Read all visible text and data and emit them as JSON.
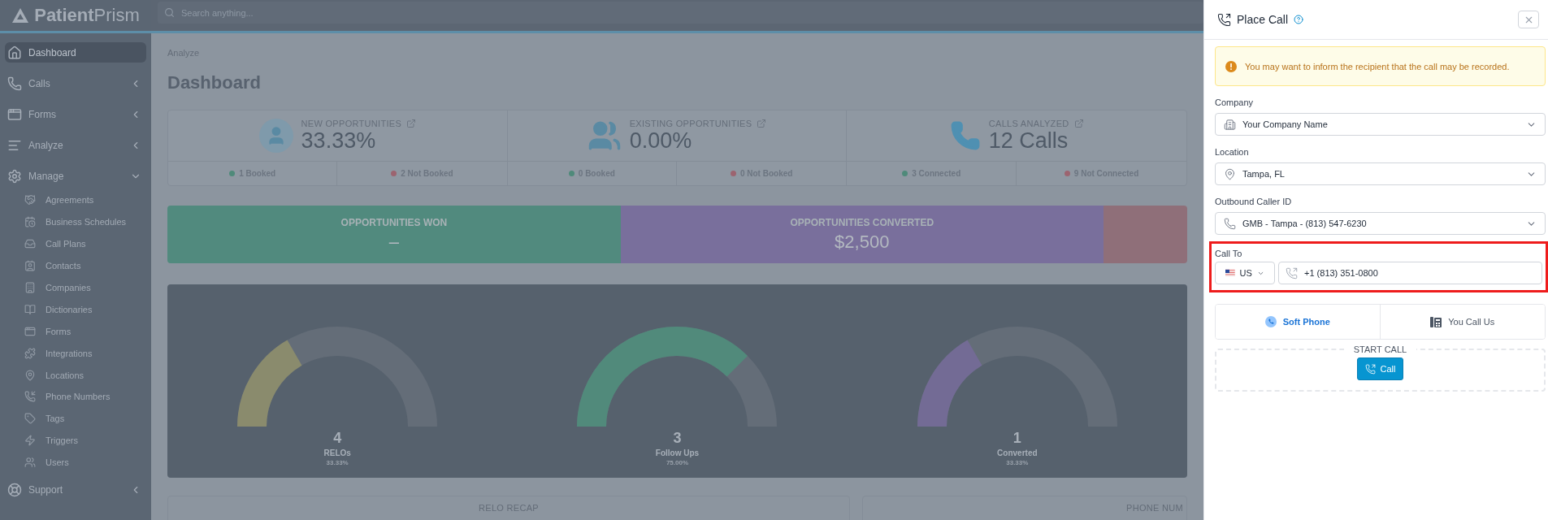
{
  "sidebar": {
    "logo": "**Patient**Prism",
    "items": [
      {
        "label": "Dashboard",
        "selected": true
      },
      {
        "label": "Calls",
        "selected": false,
        "expanded": false
      },
      {
        "label": "Forms",
        "selected": false,
        "expanded": false
      },
      {
        "label": "Analyze",
        "selected": false,
        "expanded": false
      },
      {
        "label": "Manage",
        "selected": false,
        "expanded": true,
        "children": [
          {
            "label": "Agreements",
            "selected": false
          },
          {
            "label": "Business Schedules",
            "selected": false
          },
          {
            "label": "Call Plans",
            "selected": false
          },
          {
            "label": "Contacts",
            "selected": false
          },
          {
            "label": "Companies",
            "selected": false
          },
          {
            "label": "Dictionaries",
            "selected": false
          },
          {
            "label": "Forms",
            "selected": false
          },
          {
            "label": "Integrations",
            "selected": false
          },
          {
            "label": "Locations",
            "selected": false
          },
          {
            "label": "Phone Numbers",
            "selected": false
          },
          {
            "label": "Tags",
            "selected": false
          },
          {
            "label": "Triggers",
            "selected": false
          },
          {
            "label": "Users",
            "selected": false
          }
        ]
      },
      {
        "label": "Support",
        "selected": false,
        "expanded": false
      }
    ]
  },
  "search": {
    "placeholder": "Search anything..."
  },
  "breadcrumb": "Analyze",
  "title": "Dashboard",
  "stats": [
    {
      "title": "NEW OPPORTUNITIES",
      "value": "33.33%",
      "breakdown": [
        {
          "text": "1 Booked",
          "color": "#4f8a7a"
        },
        {
          "text": "2 Not Booked",
          "color": "#9c6470"
        }
      ]
    },
    {
      "title": "EXISTING OPPORTUNITIES",
      "value": "0.00%",
      "breakdown": [
        {
          "text": "0 Booked",
          "color": "#4f8a7a"
        },
        {
          "text": "0 Not Booked",
          "color": "#9c6470"
        }
      ]
    },
    {
      "title": "CALLS ANALYZED",
      "value": "12 Calls",
      "breakdown": [
        {
          "text": "3 Connected",
          "color": "#4f8a7a"
        },
        {
          "text": "9 Not Connected",
          "color": "#9c6470"
        }
      ]
    }
  ],
  "banners": [
    {
      "label": "OPPORTUNITIES WON",
      "value": "–",
      "color": "#518a7e"
    },
    {
      "label": "OPPORTUNITIES CONVERTED",
      "value": "$2,500",
      "color": "#796f9c"
    },
    {
      "color": "#8f6f79"
    }
  ],
  "gauges": [
    {
      "value": "4",
      "label": "RELOs",
      "percent": "33.33%",
      "color": "#8a8b6d"
    },
    {
      "value": "3",
      "label": "Follow Ups",
      "percent": "75.00%",
      "color": "#518a7b"
    },
    {
      "value": "1",
      "label": "Converted",
      "percent": "33.33%",
      "color": "#736b95"
    }
  ],
  "recaps": [
    {
      "title": "RELO RECAP"
    },
    {
      "title": "PHONE NUM"
    }
  ],
  "drawer": {
    "title": "Place Call",
    "alert": "You may want to inform the recipient that the call may be recorded.",
    "fields": [
      {
        "label": "Company",
        "value": "Your Company Name"
      },
      {
        "label": "Location",
        "value": "Tampa, FL"
      },
      {
        "label": "Outbound Caller ID",
        "value": "GMB - Tampa - (813) 547-6230"
      }
    ],
    "call_to": {
      "label": "Call To",
      "country": "US",
      "number": "+1 (813) 351-0800",
      "highlighted": true
    },
    "tabs": [
      {
        "label": "Soft Phone",
        "selected": true
      },
      {
        "label": "You Call Us",
        "selected": false
      }
    ],
    "start_call": {
      "legend": "START CALL",
      "button": "Call"
    }
  }
}
